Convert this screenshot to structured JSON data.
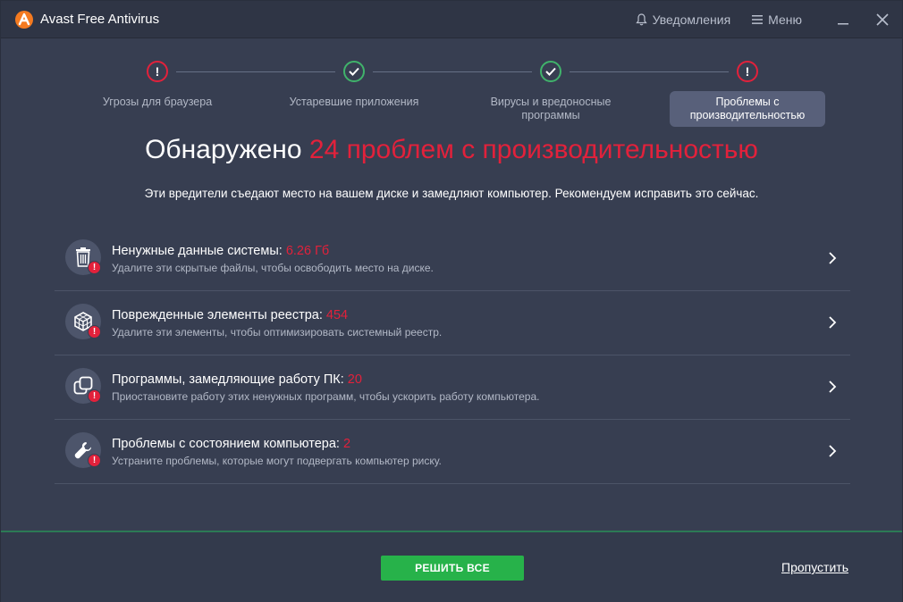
{
  "app": {
    "title": "Avast Free Antivirus"
  },
  "titlebar": {
    "notifications_label": "Уведомления",
    "menu_label": "Меню"
  },
  "steps": [
    {
      "label": "Угрозы для браузера",
      "status": "warning"
    },
    {
      "label": "Устаревшие приложения",
      "status": "ok"
    },
    {
      "label": "Вирусы и вредоносные программы",
      "status": "ok"
    },
    {
      "label": "Проблемы с производительностью",
      "status": "warning",
      "active": true
    }
  ],
  "headline": {
    "prefix": "Обнаружено",
    "highlight": "24 проблем с производительностью"
  },
  "subtitle": "Эти вредители съедают место на вашем диске и замедляют компьютер. Рекомендуем исправить это сейчас.",
  "issues": [
    {
      "icon": "trash-icon",
      "title": "Ненужные данные системы: ",
      "value": "6.26 Гб",
      "description": "Удалите эти скрытые файлы, чтобы освободить место на диске."
    },
    {
      "icon": "registry-cube-icon",
      "title": "Поврежденные элементы реестра: ",
      "value": "454",
      "description": "Удалите эти элементы, чтобы оптимизировать системный реестр."
    },
    {
      "icon": "windows-overlap-icon",
      "title": "Программы, замедляющие работу ПК: ",
      "value": "20",
      "description": "Приостановите работу этих ненужных программ, чтобы ускорить работу компьютера."
    },
    {
      "icon": "wrench-icon",
      "title": "Проблемы с состоянием компьютера: ",
      "value": "2",
      "description": "Устраните проблемы, которые могут подвергать компьютер риску."
    }
  ],
  "footer": {
    "fix_all_label": "РЕШИТЬ ВСЕ",
    "skip_label": "Пропустить"
  },
  "colors": {
    "background": "#373e51",
    "accent_red": "#e2213b",
    "accent_green": "#27b24a",
    "logo_orange": "#f47a20"
  }
}
